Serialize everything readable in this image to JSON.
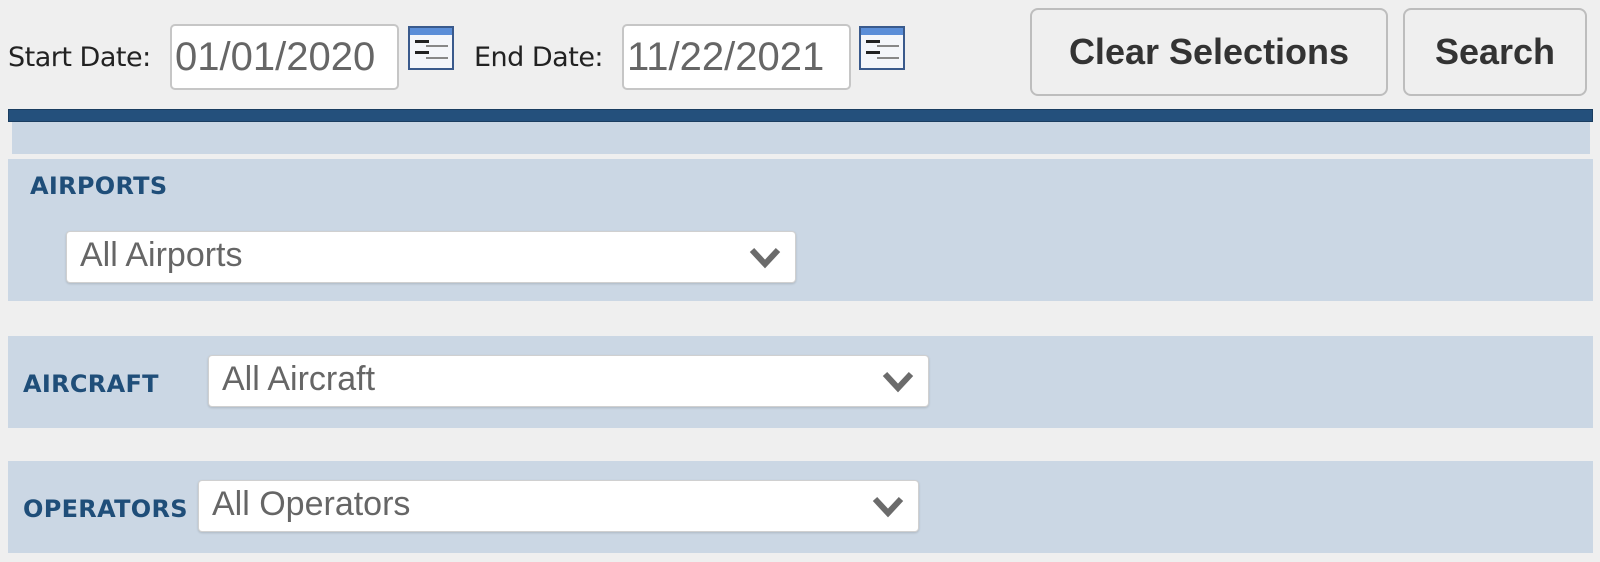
{
  "filters": {
    "start_date": {
      "label": "Start Date:",
      "value": "01/01/2020",
      "icon": "calendar-icon"
    },
    "end_date": {
      "label": "End Date:",
      "value": "11/22/2021",
      "icon": "calendar-icon"
    }
  },
  "actions": {
    "clear_label": "Clear Selections",
    "search_label": "Search"
  },
  "sections": {
    "airports": {
      "label": "AIRPORTS",
      "selected": "All Airports",
      "icon": "chevron-down-icon"
    },
    "aircraft": {
      "label": "AIRCRAFT",
      "selected": "All Aircraft",
      "icon": "chevron-down-icon"
    },
    "operators": {
      "label": "OPERATORS",
      "selected": "All Operators",
      "icon": "chevron-down-icon"
    }
  },
  "colors": {
    "accent_band": "#24507c",
    "panel_bg": "#cbd7e4",
    "label_text": "#1f4e79",
    "page_bg": "#efefef"
  }
}
